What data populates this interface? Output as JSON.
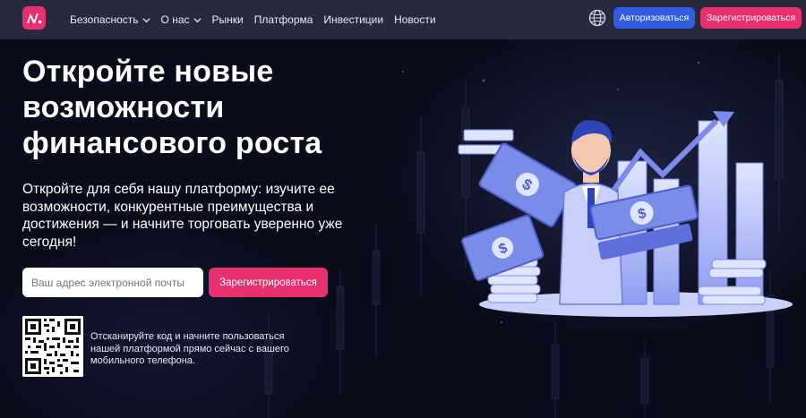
{
  "nav": {
    "items": [
      {
        "label": "Безопасность",
        "has_dropdown": true
      },
      {
        "label": "О нас",
        "has_dropdown": true
      },
      {
        "label": "Рынки",
        "has_dropdown": false
      },
      {
        "label": "Платформа",
        "has_dropdown": false
      },
      {
        "label": "Инвестиции",
        "has_dropdown": false
      },
      {
        "label": "Новости",
        "has_dropdown": false
      }
    ],
    "login_label": "Авторизоваться",
    "register_label": "Зарегистрироваться",
    "globe_icon": "globe-icon",
    "logo_icon": "brand-logo-icon"
  },
  "hero": {
    "title": "Откройте новые возможности финансового роста",
    "subtitle": "Откройте для себя нашу платформу: изучите ее возможности, конкурентные преимущества и достижения — и начните торговать уверенно уже сегодня!",
    "email_placeholder": "Ваш адрес электронной почты",
    "cta_label": "Зарегистрироваться",
    "qr_text": "Отсканируйте код и начните пользоваться нашей платформой прямо сейчас с вашего мобильного телефона."
  },
  "colors": {
    "accent_pink": "#e8306e",
    "accent_blue": "#2f5ce0",
    "nav_bg": "#262a3c",
    "page_bg": "#0a0c1b",
    "illustration": "#7b8be8"
  }
}
